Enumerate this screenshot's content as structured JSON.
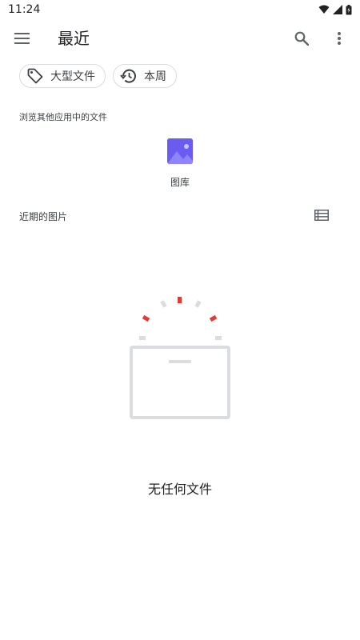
{
  "status_bar": {
    "time": "11:24",
    "icons": [
      "wifi-icon",
      "signal-icon",
      "battery-icon"
    ]
  },
  "app_bar": {
    "title": "最近",
    "menu_icon": "menu-icon",
    "search_icon": "search-icon",
    "more_icon": "more-vert-icon"
  },
  "chips": [
    {
      "label": "大型文件",
      "icon": "tag-icon"
    },
    {
      "label": "本周",
      "icon": "history-icon"
    }
  ],
  "browse_section": {
    "label": "浏览其他应用中的文件",
    "apps": [
      {
        "name": "图库",
        "icon": "gallery-icon"
      }
    ]
  },
  "recent_section": {
    "label": "近期的图片",
    "view_icon": "list-view-icon"
  },
  "empty_state": {
    "message": "无任何文件"
  },
  "colors": {
    "accent_purple": "#6a5cf0",
    "illustration_red": "#e53935",
    "illustration_gray": "#dadce0",
    "text": "#202124"
  }
}
